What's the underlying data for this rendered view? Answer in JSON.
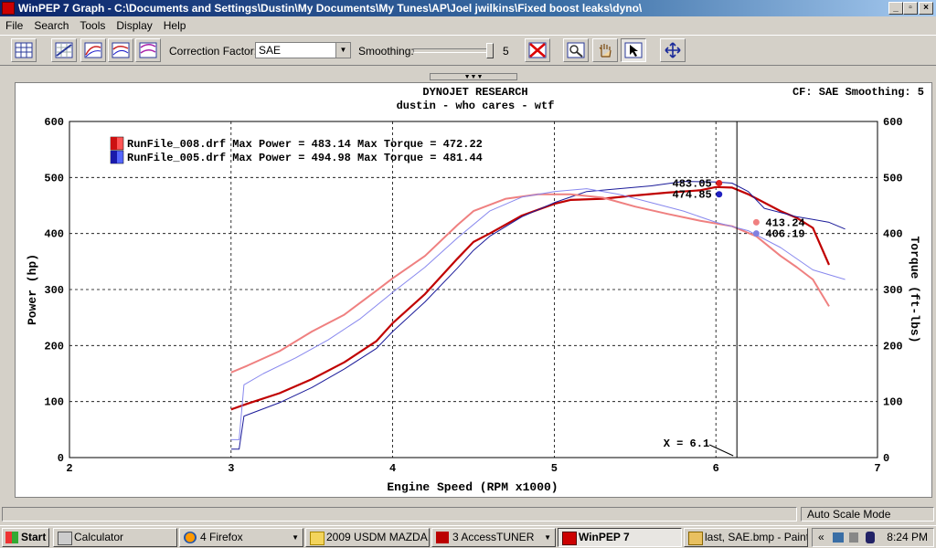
{
  "window": {
    "title": "WinPEP 7   Graph - C:\\Documents and Settings\\Dustin\\My Documents\\My Tunes\\AP\\Joel jwilkins\\Fixed boost leaks\\dyno\\"
  },
  "menu": [
    "File",
    "Search",
    "Tools",
    "Display",
    "Help"
  ],
  "toolbar": {
    "correction_label": "Correction Factor:",
    "correction_value": "SAE",
    "smoothing_label": "Smoothing:",
    "smoothing_value": "5",
    "smoothing_level": 5,
    "smoothing_max": 5
  },
  "chart_header": {
    "company": "DYNOJET RESEARCH",
    "subtitle": "dustin - who cares - wtf",
    "cf_info": "CF: SAE  Smoothing: 5"
  },
  "chart_data": {
    "type": "line",
    "xlabel": "Engine Speed (RPM x1000)",
    "ylabel_left": "Power (hp)",
    "ylabel_right": "Torque (ft-lbs)",
    "xlim": [
      2,
      7
    ],
    "ylim": [
      0,
      600
    ],
    "xticks": [
      "2",
      "3",
      "4",
      "5",
      "6",
      "7"
    ],
    "yticks": [
      "0",
      "100",
      "200",
      "300",
      "400",
      "500",
      "600"
    ],
    "grid": true,
    "legend": [
      {
        "label": "RunFile_008.drf Max Power = 483.14 Max Torque = 472.22",
        "color_dark": "#cc1111",
        "color_light": "#ff5555"
      },
      {
        "label": "RunFile_005.drf Max Power = 494.98 Max Torque = 481.44",
        "color_dark": "#1a1aaa",
        "color_light": "#5566ff"
      }
    ],
    "series": [
      {
        "name": "RunFile_008 Power",
        "color": "#c00000",
        "width": 2.2,
        "x": [
          3.0,
          3.1,
          3.3,
          3.5,
          3.7,
          3.9,
          4.0,
          4.2,
          4.4,
          4.5,
          4.6,
          4.8,
          5.0,
          5.1,
          5.3,
          5.5,
          5.7,
          5.9,
          6.0,
          6.1,
          6.2,
          6.3,
          6.4,
          6.5,
          6.6,
          6.7
        ],
        "y": [
          86,
          96,
          115,
          140,
          170,
          208,
          240,
          292,
          355,
          385,
          400,
          432,
          453,
          460,
          462,
          468,
          473,
          477,
          483,
          482,
          470,
          455,
          440,
          428,
          410,
          344
        ]
      },
      {
        "name": "RunFile_005 Power",
        "color": "#1a1a99",
        "width": 1.0,
        "x": [
          3.0,
          3.05,
          3.08,
          3.3,
          3.5,
          3.7,
          3.9,
          4.0,
          4.2,
          4.4,
          4.5,
          4.6,
          4.8,
          5.0,
          5.2,
          5.4,
          5.6,
          5.8,
          6.0,
          6.1,
          6.2,
          6.3,
          6.5,
          6.6,
          6.7,
          6.8
        ],
        "y": [
          15,
          15,
          74,
          98,
          125,
          158,
          195,
          225,
          278,
          338,
          370,
          395,
          430,
          455,
          475,
          480,
          485,
          493,
          492,
          490,
          475,
          445,
          430,
          425,
          420,
          408
        ]
      },
      {
        "name": "RunFile_008 Torque",
        "color": "#ef8080",
        "width": 2.0,
        "x": [
          3.0,
          3.1,
          3.3,
          3.5,
          3.7,
          3.9,
          4.0,
          4.2,
          4.4,
          4.5,
          4.7,
          4.9,
          5.1,
          5.3,
          5.5,
          5.7,
          5.9,
          6.1,
          6.25,
          6.4,
          6.5,
          6.6,
          6.7
        ],
        "y": [
          152,
          164,
          190,
          225,
          255,
          298,
          320,
          360,
          415,
          440,
          462,
          470,
          470,
          464,
          448,
          435,
          423,
          413,
          395,
          360,
          340,
          318,
          270
        ]
      },
      {
        "name": "RunFile_005 Torque",
        "color": "#8888ee",
        "width": 1.0,
        "x": [
          3.0,
          3.05,
          3.08,
          3.2,
          3.4,
          3.6,
          3.8,
          4.0,
          4.2,
          4.4,
          4.6,
          4.8,
          5.0,
          5.2,
          5.4,
          5.6,
          5.8,
          6.0,
          6.2,
          6.4,
          6.6,
          6.8
        ],
        "y": [
          32,
          32,
          130,
          150,
          178,
          210,
          248,
          295,
          340,
          392,
          440,
          465,
          475,
          480,
          470,
          455,
          440,
          420,
          405,
          375,
          335,
          318
        ]
      }
    ],
    "markers": [
      {
        "x": 6.02,
        "y": 490,
        "color": "#e02020",
        "label": "483.05",
        "side": "left"
      },
      {
        "x": 6.02,
        "y": 470,
        "color": "#2020c0",
        "label": "474.85",
        "side": "left"
      },
      {
        "x": 6.25,
        "y": 420,
        "color": "#f08080",
        "label": "413.24",
        "side": "right"
      },
      {
        "x": 6.25,
        "y": 400,
        "color": "#8080e0",
        "label": "406.19",
        "side": "right"
      }
    ],
    "cursor": {
      "x": 6.13,
      "label": "X = 6.1"
    }
  },
  "status": {
    "right": "Auto Scale Mode"
  },
  "taskbar": {
    "start": "Start",
    "items": [
      {
        "label": "Calculator",
        "icon": "calculator-icon",
        "active": false
      },
      {
        "label": "4 Firefox",
        "icon": "firefox-icon",
        "active": false
      },
      {
        "label": "2009 USDM MAZDA...",
        "icon": "folder-icon",
        "active": false
      },
      {
        "label": "3 AccessTUNER",
        "icon": "accesstuner-icon",
        "active": false
      },
      {
        "label": "WinPEP 7",
        "icon": "winpep-icon",
        "active": true
      },
      {
        "label": "last, SAE.bmp - Paint",
        "icon": "paint-icon",
        "active": false
      }
    ],
    "tray_time": "8:24 PM"
  }
}
